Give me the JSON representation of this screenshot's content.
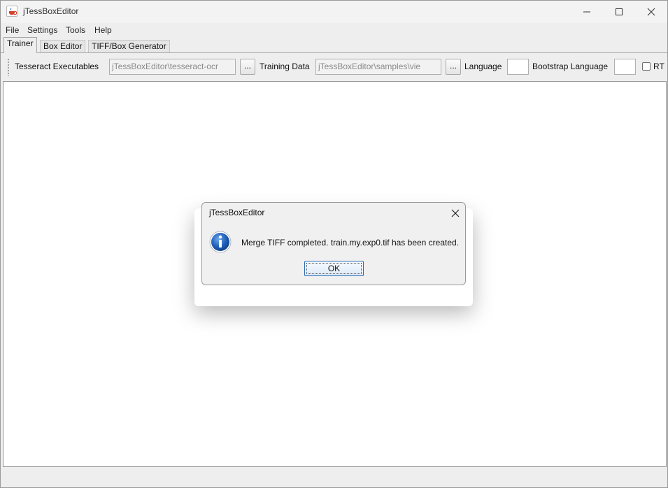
{
  "window": {
    "title": "jTessBoxEditor"
  },
  "menu": [
    "File",
    "Settings",
    "Tools",
    "Help"
  ],
  "tabs": [
    "Trainer",
    "Box Editor",
    "TIFF/Box Generator"
  ],
  "toolbar": {
    "tesseract_label": "Tesseract Executables",
    "tesseract_value": "jTessBoxEditor\\tesseract-ocr",
    "browse_label": "...",
    "training_label": "Training Data",
    "training_value": "jTessBoxEditor\\samples\\vie",
    "language_label": "Language",
    "language_value": "",
    "bootstrap_label": "Bootstrap Language",
    "bootstrap_value": "",
    "rtl_label": "RT"
  },
  "dialog": {
    "title": "jTessBoxEditor",
    "message": "Merge TIFF completed. train.my.exp0.tif has been created.",
    "ok_label": "OK",
    "icon": "info-icon"
  },
  "colors": {
    "accent": "#2c6bb5",
    "info_icon": "#1f5fb8"
  }
}
